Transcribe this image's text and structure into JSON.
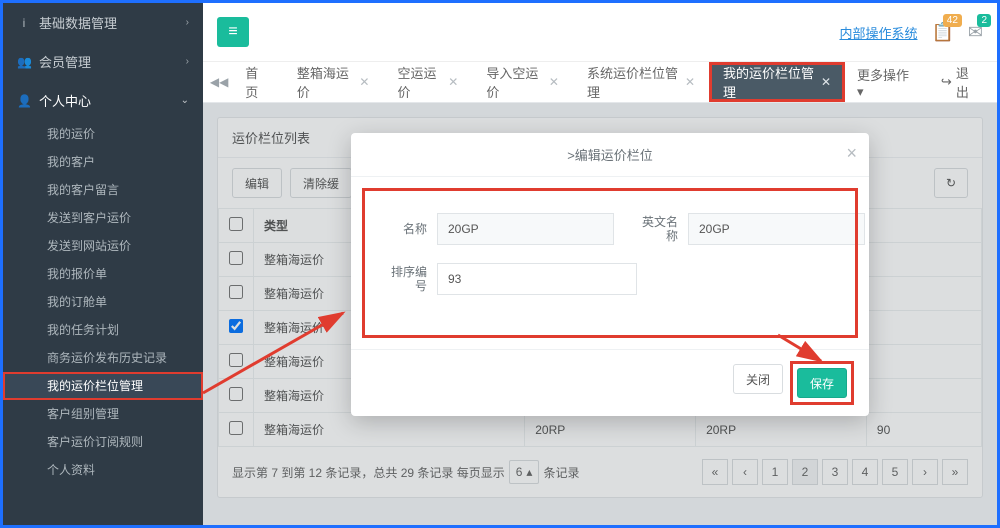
{
  "sidebar": {
    "groups": [
      {
        "icon": "i",
        "label": "基础数据管理",
        "expanded": false
      },
      {
        "icon": "👥",
        "label": "会员管理",
        "expanded": false
      },
      {
        "icon": "👤",
        "label": "个人中心",
        "expanded": true
      }
    ],
    "items": [
      "我的运价",
      "我的客户",
      "我的客户留言",
      "发送到客户运价",
      "发送到网站运价",
      "我的报价单",
      "我的订舱单",
      "我的任务计划",
      "商务运价发布历史记录",
      "我的运价栏位管理",
      "客户组别管理",
      "客户运价订阅规则",
      "个人资料"
    ],
    "active_index": 9
  },
  "topbar": {
    "system_link": "内部操作系统",
    "notif1": "42",
    "notif2": "2"
  },
  "tabs": {
    "scroll_left": "◀◀",
    "items": [
      {
        "label": "首页",
        "closable": false
      },
      {
        "label": "整箱海运价",
        "closable": true
      },
      {
        "label": "空运运价",
        "closable": true
      },
      {
        "label": "导入空运价",
        "closable": true
      },
      {
        "label": "系统运价栏位管理",
        "closable": true
      },
      {
        "label": "我的运价栏位管理",
        "closable": true
      }
    ],
    "active_index": 5,
    "more": "更多操作",
    "logout": "退出"
  },
  "card": {
    "title": "运价栏位列表",
    "btn_edit": "编辑",
    "btn_clear": "清除缓",
    "col_type": "类型",
    "row_label": "整箱海运价",
    "row_20rp_a": "20RP",
    "row_20rp_b": "20RP",
    "row_num": "90",
    "pager_text_a": "显示第 7 到第 12 条记录，总共 29 条记录 每页显示",
    "pager_select": "6",
    "pager_text_b": "条记录",
    "pages": [
      "«",
      "‹",
      "1",
      "2",
      "3",
      "4",
      "5",
      "›",
      "»"
    ],
    "page_active": "2"
  },
  "modal": {
    "title": ">编辑运价栏位",
    "lbl_name": "名称",
    "val_name": "20GP",
    "lbl_ename": "英文名称",
    "val_ename": "20GP",
    "lbl_sort": "排序编号",
    "val_sort": "93",
    "btn_close": "关闭",
    "btn_save": "保存"
  }
}
